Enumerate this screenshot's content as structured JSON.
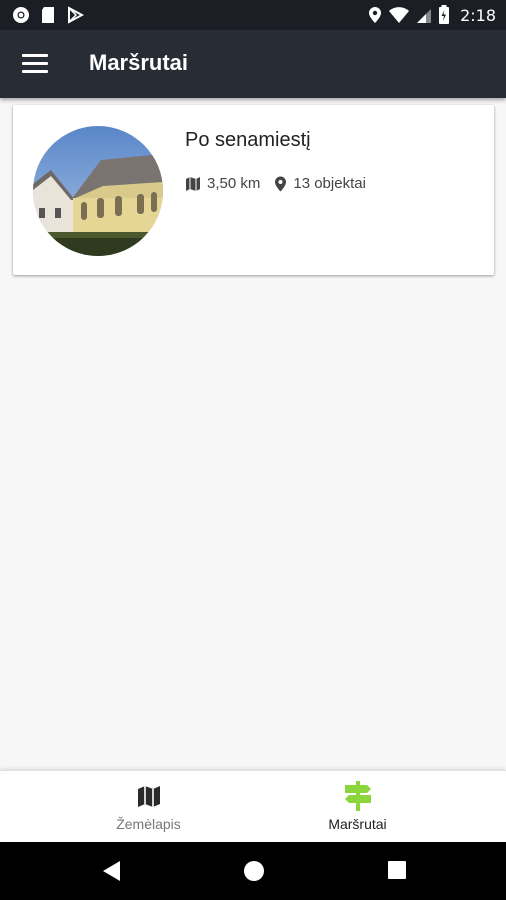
{
  "status_bar": {
    "time": "2:18",
    "icons": [
      "chrome-icon",
      "sd-card-icon",
      "play-store-icon",
      "location-icon",
      "wifi-icon",
      "signal-icon",
      "battery-icon"
    ]
  },
  "app_bar": {
    "title": "Maršrutai",
    "menu_icon": "hamburger-menu-icon"
  },
  "routes": [
    {
      "title": "Po senamiestį",
      "distance": "3,50 km",
      "objects": "13 objektai",
      "distance_icon": "map-icon",
      "objects_icon": "location-pin-icon"
    }
  ],
  "bottom_nav": {
    "items": [
      {
        "label": "Žemėlapis",
        "icon": "map-icon",
        "active": false
      },
      {
        "label": "Maršrutai",
        "icon": "signpost-icon",
        "active": true
      }
    ],
    "active_color": "#8bd63a"
  },
  "system_nav": [
    "back-icon",
    "home-icon",
    "recents-icon"
  ],
  "colors": {
    "app_bar": "#282c34",
    "status_bar": "#1b1e24",
    "accent": "#8bd63a",
    "background": "#f7f7f7"
  }
}
